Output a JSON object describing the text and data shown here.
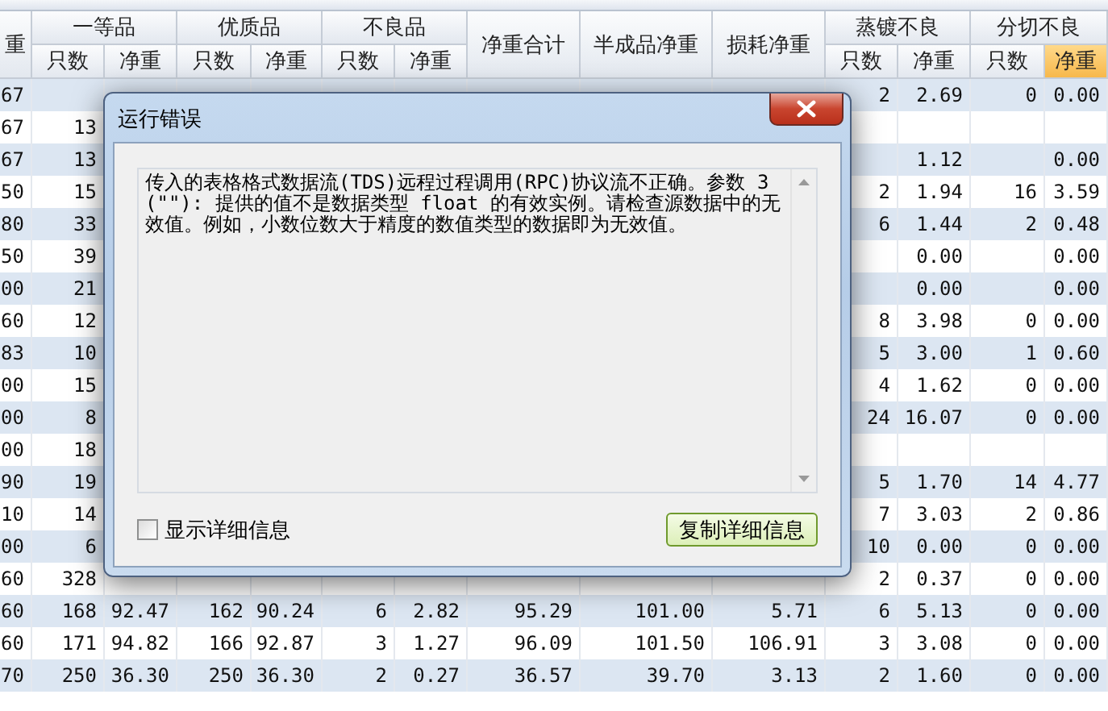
{
  "table": {
    "columns": [
      {
        "kind": "single",
        "label": "重"
      },
      {
        "kind": "sub",
        "group": "一等品",
        "label": "只数",
        "selected": false
      },
      {
        "kind": "sub",
        "label": "净重",
        "selected": false
      },
      {
        "kind": "sub",
        "group": "优质品",
        "label": "只数",
        "selected": false
      },
      {
        "kind": "sub",
        "label": "净重",
        "selected": false
      },
      {
        "kind": "sub",
        "group": "不良品",
        "label": "只数",
        "selected": false
      },
      {
        "kind": "sub",
        "label": "净重",
        "selected": false
      },
      {
        "kind": "single",
        "label": "净重合计"
      },
      {
        "kind": "single",
        "label": "半成品净重"
      },
      {
        "kind": "single",
        "label": "损耗净重"
      },
      {
        "kind": "sub",
        "group": "蒸镀不良",
        "label": "只数",
        "selected": false
      },
      {
        "kind": "sub",
        "label": "净重",
        "selected": false
      },
      {
        "kind": "sub",
        "group": "分切不良",
        "label": "只数",
        "selected": false
      },
      {
        "kind": "sub",
        "label": "净重",
        "selected": true
      }
    ],
    "rows": [
      {
        "cells": [
          "67",
          null,
          null,
          null,
          null,
          null,
          null,
          null,
          null,
          null,
          "2",
          "2.69",
          "0",
          "0.00"
        ]
      },
      {
        "cells": [
          "67",
          "13",
          null,
          null,
          null,
          null,
          null,
          null,
          null,
          null,
          null,
          null,
          null,
          null
        ]
      },
      {
        "cells": [
          "67",
          "13",
          null,
          null,
          null,
          null,
          null,
          null,
          null,
          null,
          null,
          "1.12",
          null,
          "0.00"
        ]
      },
      {
        "cells": [
          "50",
          "15",
          null,
          null,
          null,
          null,
          null,
          null,
          null,
          null,
          "2",
          "1.94",
          "16",
          "3.59"
        ]
      },
      {
        "cells": [
          "80",
          "33",
          null,
          null,
          null,
          null,
          null,
          null,
          null,
          null,
          "6",
          "1.44",
          "2",
          "0.48"
        ]
      },
      {
        "cells": [
          "50",
          "39",
          null,
          null,
          null,
          null,
          null,
          null,
          null,
          null,
          null,
          "0.00",
          null,
          "0.00"
        ]
      },
      {
        "cells": [
          "00",
          "21",
          null,
          null,
          null,
          null,
          null,
          null,
          null,
          null,
          null,
          "0.00",
          null,
          "0.00"
        ]
      },
      {
        "cells": [
          "60",
          "12",
          null,
          null,
          null,
          null,
          null,
          null,
          null,
          null,
          "8",
          "3.98",
          "0",
          "0.00"
        ]
      },
      {
        "cells": [
          "83",
          "10",
          null,
          null,
          null,
          null,
          null,
          null,
          null,
          null,
          "5",
          "3.00",
          "1",
          "0.60"
        ]
      },
      {
        "cells": [
          "00",
          "15",
          null,
          null,
          null,
          null,
          null,
          null,
          null,
          null,
          "4",
          "1.62",
          "0",
          "0.00"
        ]
      },
      {
        "cells": [
          "00",
          "8",
          null,
          null,
          null,
          null,
          null,
          null,
          null,
          null,
          "24",
          "16.07",
          "0",
          "0.00"
        ]
      },
      {
        "cells": [
          "00",
          "18",
          null,
          null,
          null,
          null,
          null,
          null,
          null,
          null,
          null,
          null,
          null,
          null
        ]
      },
      {
        "cells": [
          "90",
          "19",
          null,
          null,
          null,
          null,
          null,
          null,
          null,
          null,
          "5",
          "1.70",
          "14",
          "4.77"
        ]
      },
      {
        "cells": [
          "10",
          "14",
          null,
          null,
          null,
          null,
          null,
          null,
          null,
          null,
          "7",
          "3.03",
          "2",
          "0.86"
        ]
      },
      {
        "cells": [
          "00",
          "6",
          null,
          null,
          null,
          null,
          null,
          null,
          null,
          null,
          "10",
          "0.00",
          "0",
          "0.00"
        ]
      },
      {
        "cells": [
          "60",
          "328",
          null,
          null,
          null,
          null,
          null,
          null,
          null,
          null,
          "2",
          "0.37",
          "0",
          "0.00"
        ]
      },
      {
        "cells": [
          "60",
          "168",
          "92.47",
          "162",
          "90.24",
          "6",
          "2.82",
          "95.29",
          "101.00",
          "5.71",
          "6",
          "5.13",
          "0",
          "0.00"
        ]
      },
      {
        "cells": [
          "60",
          "171",
          "94.82",
          "166",
          "92.87",
          "3",
          "1.27",
          "96.09",
          "101.50",
          "106.91",
          "3",
          "3.08",
          "0",
          "0.00"
        ]
      },
      {
        "cells": [
          "70",
          "250",
          "36.30",
          "250",
          "36.30",
          "2",
          "0.27",
          "36.57",
          "39.70",
          "3.13",
          "2",
          "1.60",
          "0",
          "0.00"
        ]
      }
    ]
  },
  "dialog": {
    "title": "运行错误",
    "message": "传入的表格格式数据流(TDS)远程过程调用(RPC)协议流不正确。参数 3 (\"\"): 提供的值不是数据类型 float 的有效实例。请检查源数据中的无效值。例如，小数位数大于精度的数值类型的数据即为无效值。",
    "show_details": {
      "label": "显示详细信息",
      "checked": false
    },
    "copy_button": "复制详细信息"
  }
}
